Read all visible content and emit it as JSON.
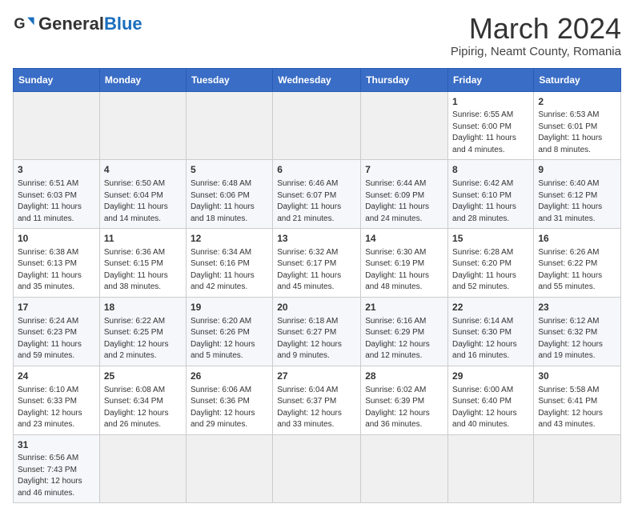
{
  "header": {
    "logo_general": "General",
    "logo_blue": "Blue",
    "month_title": "March 2024",
    "subtitle": "Pipirig, Neamt County, Romania"
  },
  "days_of_week": [
    "Sunday",
    "Monday",
    "Tuesday",
    "Wednesday",
    "Thursday",
    "Friday",
    "Saturday"
  ],
  "weeks": [
    [
      {
        "day": "",
        "info": ""
      },
      {
        "day": "",
        "info": ""
      },
      {
        "day": "",
        "info": ""
      },
      {
        "day": "",
        "info": ""
      },
      {
        "day": "",
        "info": ""
      },
      {
        "day": "1",
        "info": "Sunrise: 6:55 AM\nSunset: 6:00 PM\nDaylight: 11 hours and 4 minutes."
      },
      {
        "day": "2",
        "info": "Sunrise: 6:53 AM\nSunset: 6:01 PM\nDaylight: 11 hours and 8 minutes."
      }
    ],
    [
      {
        "day": "3",
        "info": "Sunrise: 6:51 AM\nSunset: 6:03 PM\nDaylight: 11 hours and 11 minutes."
      },
      {
        "day": "4",
        "info": "Sunrise: 6:50 AM\nSunset: 6:04 PM\nDaylight: 11 hours and 14 minutes."
      },
      {
        "day": "5",
        "info": "Sunrise: 6:48 AM\nSunset: 6:06 PM\nDaylight: 11 hours and 18 minutes."
      },
      {
        "day": "6",
        "info": "Sunrise: 6:46 AM\nSunset: 6:07 PM\nDaylight: 11 hours and 21 minutes."
      },
      {
        "day": "7",
        "info": "Sunrise: 6:44 AM\nSunset: 6:09 PM\nDaylight: 11 hours and 24 minutes."
      },
      {
        "day": "8",
        "info": "Sunrise: 6:42 AM\nSunset: 6:10 PM\nDaylight: 11 hours and 28 minutes."
      },
      {
        "day": "9",
        "info": "Sunrise: 6:40 AM\nSunset: 6:12 PM\nDaylight: 11 hours and 31 minutes."
      }
    ],
    [
      {
        "day": "10",
        "info": "Sunrise: 6:38 AM\nSunset: 6:13 PM\nDaylight: 11 hours and 35 minutes."
      },
      {
        "day": "11",
        "info": "Sunrise: 6:36 AM\nSunset: 6:15 PM\nDaylight: 11 hours and 38 minutes."
      },
      {
        "day": "12",
        "info": "Sunrise: 6:34 AM\nSunset: 6:16 PM\nDaylight: 11 hours and 42 minutes."
      },
      {
        "day": "13",
        "info": "Sunrise: 6:32 AM\nSunset: 6:17 PM\nDaylight: 11 hours and 45 minutes."
      },
      {
        "day": "14",
        "info": "Sunrise: 6:30 AM\nSunset: 6:19 PM\nDaylight: 11 hours and 48 minutes."
      },
      {
        "day": "15",
        "info": "Sunrise: 6:28 AM\nSunset: 6:20 PM\nDaylight: 11 hours and 52 minutes."
      },
      {
        "day": "16",
        "info": "Sunrise: 6:26 AM\nSunset: 6:22 PM\nDaylight: 11 hours and 55 minutes."
      }
    ],
    [
      {
        "day": "17",
        "info": "Sunrise: 6:24 AM\nSunset: 6:23 PM\nDaylight: 11 hours and 59 minutes."
      },
      {
        "day": "18",
        "info": "Sunrise: 6:22 AM\nSunset: 6:25 PM\nDaylight: 12 hours and 2 minutes."
      },
      {
        "day": "19",
        "info": "Sunrise: 6:20 AM\nSunset: 6:26 PM\nDaylight: 12 hours and 5 minutes."
      },
      {
        "day": "20",
        "info": "Sunrise: 6:18 AM\nSunset: 6:27 PM\nDaylight: 12 hours and 9 minutes."
      },
      {
        "day": "21",
        "info": "Sunrise: 6:16 AM\nSunset: 6:29 PM\nDaylight: 12 hours and 12 minutes."
      },
      {
        "day": "22",
        "info": "Sunrise: 6:14 AM\nSunset: 6:30 PM\nDaylight: 12 hours and 16 minutes."
      },
      {
        "day": "23",
        "info": "Sunrise: 6:12 AM\nSunset: 6:32 PM\nDaylight: 12 hours and 19 minutes."
      }
    ],
    [
      {
        "day": "24",
        "info": "Sunrise: 6:10 AM\nSunset: 6:33 PM\nDaylight: 12 hours and 23 minutes."
      },
      {
        "day": "25",
        "info": "Sunrise: 6:08 AM\nSunset: 6:34 PM\nDaylight: 12 hours and 26 minutes."
      },
      {
        "day": "26",
        "info": "Sunrise: 6:06 AM\nSunset: 6:36 PM\nDaylight: 12 hours and 29 minutes."
      },
      {
        "day": "27",
        "info": "Sunrise: 6:04 AM\nSunset: 6:37 PM\nDaylight: 12 hours and 33 minutes."
      },
      {
        "day": "28",
        "info": "Sunrise: 6:02 AM\nSunset: 6:39 PM\nDaylight: 12 hours and 36 minutes."
      },
      {
        "day": "29",
        "info": "Sunrise: 6:00 AM\nSunset: 6:40 PM\nDaylight: 12 hours and 40 minutes."
      },
      {
        "day": "30",
        "info": "Sunrise: 5:58 AM\nSunset: 6:41 PM\nDaylight: 12 hours and 43 minutes."
      }
    ],
    [
      {
        "day": "31",
        "info": "Sunrise: 6:56 AM\nSunset: 7:43 PM\nDaylight: 12 hours and 46 minutes."
      },
      {
        "day": "",
        "info": ""
      },
      {
        "day": "",
        "info": ""
      },
      {
        "day": "",
        "info": ""
      },
      {
        "day": "",
        "info": ""
      },
      {
        "day": "",
        "info": ""
      },
      {
        "day": "",
        "info": ""
      }
    ]
  ]
}
